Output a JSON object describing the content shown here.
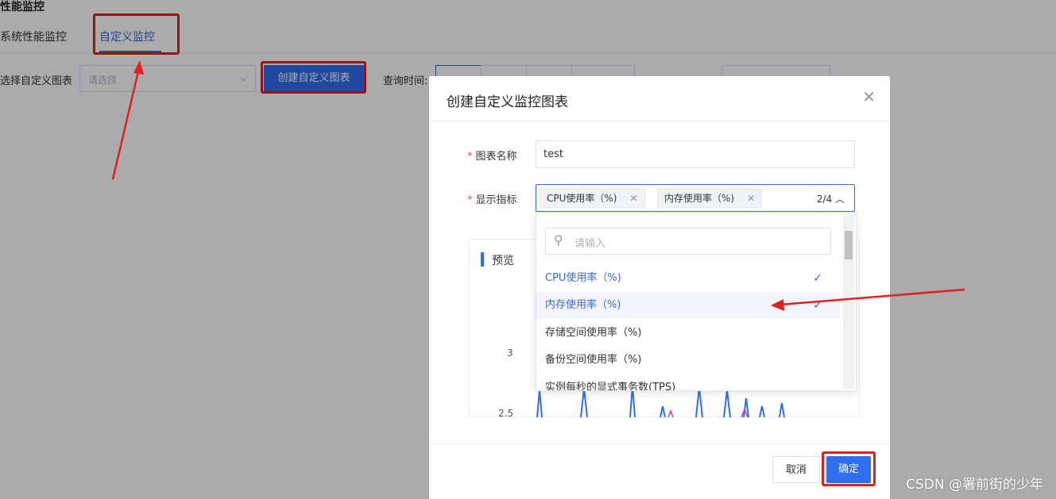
{
  "page": {
    "title": "性能监控",
    "tabs": [
      {
        "label": "系统性能监控",
        "active": false
      },
      {
        "label": "自定义监控",
        "active": true
      }
    ]
  },
  "toolbar": {
    "select_label": "选择自定义图表",
    "select_placeholder": "请选择",
    "create_button": "创建自定义图表",
    "query_time_label": "查询时间:"
  },
  "dialog": {
    "title": "创建自定义监控图表",
    "chart_name_label": "图表名称",
    "chart_name_value": "test",
    "metrics_label": "显示指标",
    "selected_tags": [
      "CPU使用率（%)",
      "内存使用率（%)"
    ],
    "selected_count": "2/4",
    "search_placeholder": "请输入",
    "options": [
      {
        "label": "CPU使用率（%)",
        "selected": true
      },
      {
        "label": "内存使用率（%)",
        "selected": true
      },
      {
        "label": "存储空间使用率（%)",
        "selected": false
      },
      {
        "label": "备份空间使用率（%)",
        "selected": false
      },
      {
        "label": "实例每秒的显式事务数(TPS)",
        "selected": false
      }
    ],
    "preview_title": "预览",
    "y_ticks": [
      "3",
      "2.5"
    ],
    "cancel_button": "取消",
    "confirm_button": "确定"
  },
  "watermark": "CSDN @署前街的少年",
  "colors": {
    "primary": "#2f6ef0",
    "accent_text": "#3a67d6",
    "annotation_red": "#e02020",
    "required": "#e74c3c"
  }
}
